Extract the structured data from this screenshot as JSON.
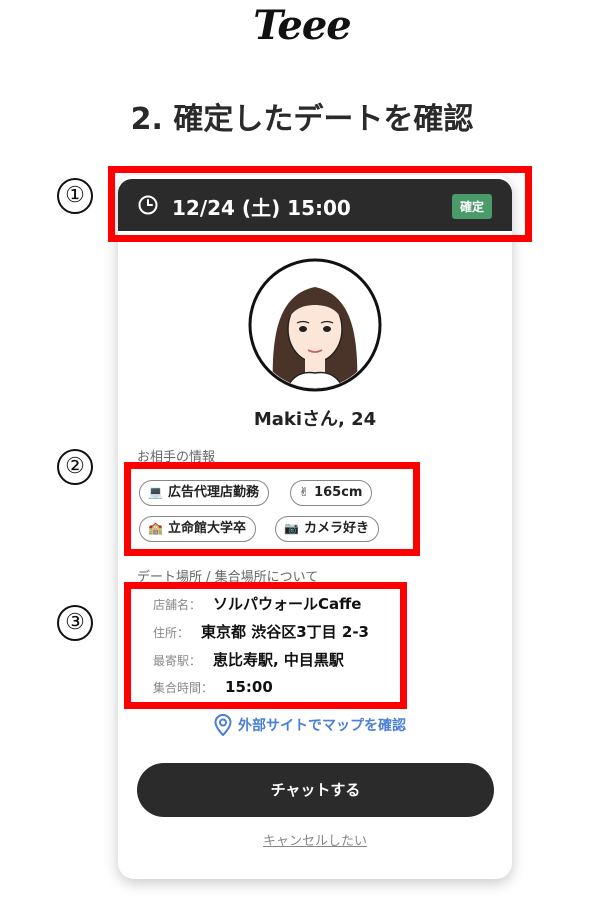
{
  "app": {
    "logo": "Teee"
  },
  "step_title": "2. 確定したデートを確認",
  "date_bar": {
    "datetime": "12/24 (土) 15:00",
    "status_badge": "確定"
  },
  "annotations": {
    "marker_1": "①",
    "marker_2": "②",
    "marker_3": "③"
  },
  "profile": {
    "name": "Makiさん, 24"
  },
  "partner_info": {
    "label": "お相手の情報",
    "tags": [
      {
        "icon": "laptop-icon",
        "label": "広告代理店勤務"
      },
      {
        "icon": "victory-hand-icon",
        "label": "165cm"
      },
      {
        "icon": "school-icon",
        "label": "立命館大学卒"
      },
      {
        "icon": "camera-icon",
        "label": "カメラ好き"
      }
    ]
  },
  "meeting": {
    "label": "デート場所 / 集合場所について",
    "rows": [
      {
        "label": "店舗名：",
        "value": "ソルパウォールCaffe"
      },
      {
        "label": "住所：",
        "value": "東京都 渋谷区3丁目 2-3"
      },
      {
        "label": "最寄駅：",
        "value": "恵比寿駅, 中目黒駅"
      },
      {
        "label": "集合時間：",
        "value": "15:00"
      }
    ],
    "map_link": "外部サイトでマップを確認"
  },
  "actions": {
    "chat_button": "チャットする",
    "cancel_link": "キャンセルしたい"
  },
  "colors": {
    "dark": "#2b2b2b",
    "badge_green": "#4a9a6a",
    "link_blue": "#4a7fd6",
    "annotation_red": "#ff0000"
  }
}
